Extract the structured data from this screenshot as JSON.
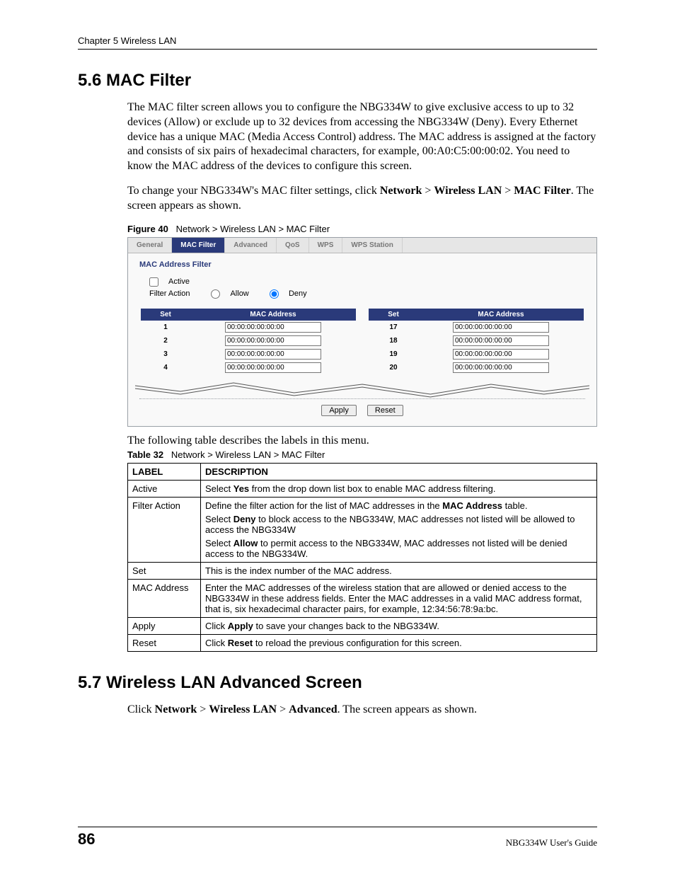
{
  "header": {
    "chapter": "Chapter 5 Wireless LAN"
  },
  "section56": {
    "title": "5.6  MAC Filter",
    "para1": "The MAC filter screen allows you to configure the NBG334W to give exclusive access to up to 32 devices (Allow) or exclude up to 32 devices from accessing the NBG334W (Deny). Every Ethernet device has a unique MAC (Media Access Control) address. The MAC address is assigned at the factory and consists of six pairs of hexadecimal characters, for example, 00:A0:C5:00:00:02. You need to know the MAC address of the devices to configure this screen.",
    "para2_pre": "To change your NBG334W's MAC filter settings, click ",
    "para2_b1": "Network",
    "para2_gt1": " > ",
    "para2_b2": "Wireless LAN",
    "para2_gt2": " > ",
    "para2_b3": "MAC Filter",
    "para2_post": ". The screen appears as shown."
  },
  "figure": {
    "label": "Figure 40",
    "caption": "Network > Wireless LAN > MAC Filter",
    "tabs": [
      "General",
      "MAC Filter",
      "Advanced",
      "QoS",
      "WPS",
      "WPS Station"
    ],
    "active_tab": 1,
    "section_title": "MAC Address Filter",
    "active_label": "Active",
    "filter_action_label": "Filter Action",
    "allow_label": "Allow",
    "deny_label": "Deny",
    "col_set": "Set",
    "col_mac": "MAC Address",
    "left_rows": [
      {
        "n": "1",
        "v": "00:00:00:00:00:00"
      },
      {
        "n": "2",
        "v": "00:00:00:00:00:00"
      },
      {
        "n": "3",
        "v": "00:00:00:00:00:00"
      },
      {
        "n": "4",
        "v": "00:00:00:00:00:00"
      }
    ],
    "right_rows": [
      {
        "n": "17",
        "v": "00:00:00:00:00:00"
      },
      {
        "n": "18",
        "v": "00:00:00:00:00:00"
      },
      {
        "n": "19",
        "v": "00:00:00:00:00:00"
      },
      {
        "n": "20",
        "v": "00:00:00:00:00:00"
      }
    ],
    "apply": "Apply",
    "reset": "Reset"
  },
  "after_figure": "The following table describes the labels in this menu.",
  "table": {
    "label": "Table 32",
    "caption": "Network > Wireless LAN > MAC Filter",
    "h1": "LABEL",
    "h2": "DESCRIPTION",
    "rows": [
      {
        "l": "Active",
        "d_pre": "Select ",
        "d_b": "Yes",
        "d_post": " from the drop down list box to enable MAC address filtering."
      },
      {
        "l": "Filter Action",
        "d1_pre": "Define the filter action for the list of MAC addresses in the ",
        "d1_b": "MAC Address",
        "d1_post": " table.",
        "d2_pre": "Select ",
        "d2_b": "Deny",
        "d2_post": " to block access to the NBG334W, MAC addresses not listed will be allowed to access the NBG334W",
        "d3_pre": "Select ",
        "d3_b": "Allow",
        "d3_post": " to permit access to the NBG334W, MAC addresses not listed will be denied access to the NBG334W."
      },
      {
        "l": "Set",
        "d": "This is the index number of the MAC address."
      },
      {
        "l": "MAC Address",
        "d": "Enter the MAC addresses of the wireless station that are allowed or denied access to the NBG334W in these address fields. Enter the MAC addresses in a valid MAC address format, that is, six hexadecimal character pairs, for example, 12:34:56:78:9a:bc."
      },
      {
        "l": "Apply",
        "d_pre": "Click ",
        "d_b": "Apply",
        "d_post": " to save your changes back to the NBG334W."
      },
      {
        "l": "Reset",
        "d_pre": "Click ",
        "d_b": "Reset",
        "d_post": " to reload the previous configuration for this screen."
      }
    ]
  },
  "section57": {
    "title": "5.7  Wireless LAN Advanced Screen",
    "para_pre": "Click ",
    "b1": "Network",
    "gt1": " > ",
    "b2": "Wireless LAN",
    "gt2": " > ",
    "b3": "Advanced",
    "para_post": ". The screen appears as shown."
  },
  "footer": {
    "page": "86",
    "book": "NBG334W User's Guide"
  }
}
